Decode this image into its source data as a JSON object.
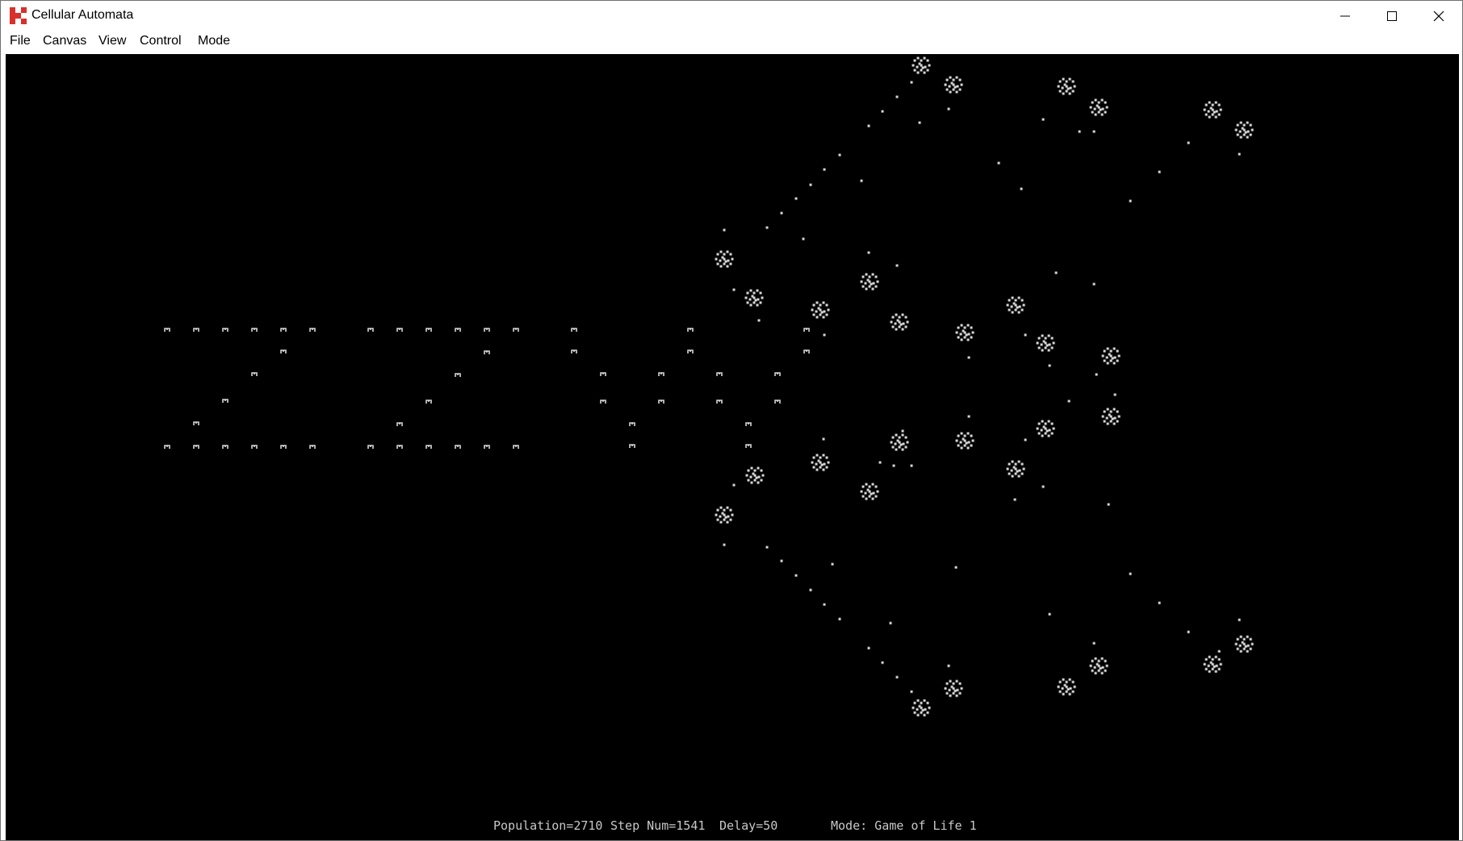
{
  "window": {
    "title": "Cellular Automata",
    "icon": "app-grid-icon",
    "controls": [
      "minimize-icon",
      "maximize-icon",
      "close-icon"
    ]
  },
  "menu": {
    "items": [
      "File",
      "Canvas",
      "View",
      "Control",
      "Mode"
    ]
  },
  "status": {
    "population": "Population=2710",
    "step": "Step Num=1541",
    "delay": "Delay=50",
    "mode": "Mode: Game of Life 1"
  },
  "colors": {
    "canvas_background": "#000000",
    "cell": "#d8d8d8",
    "icon_red": "#d9302c"
  }
}
